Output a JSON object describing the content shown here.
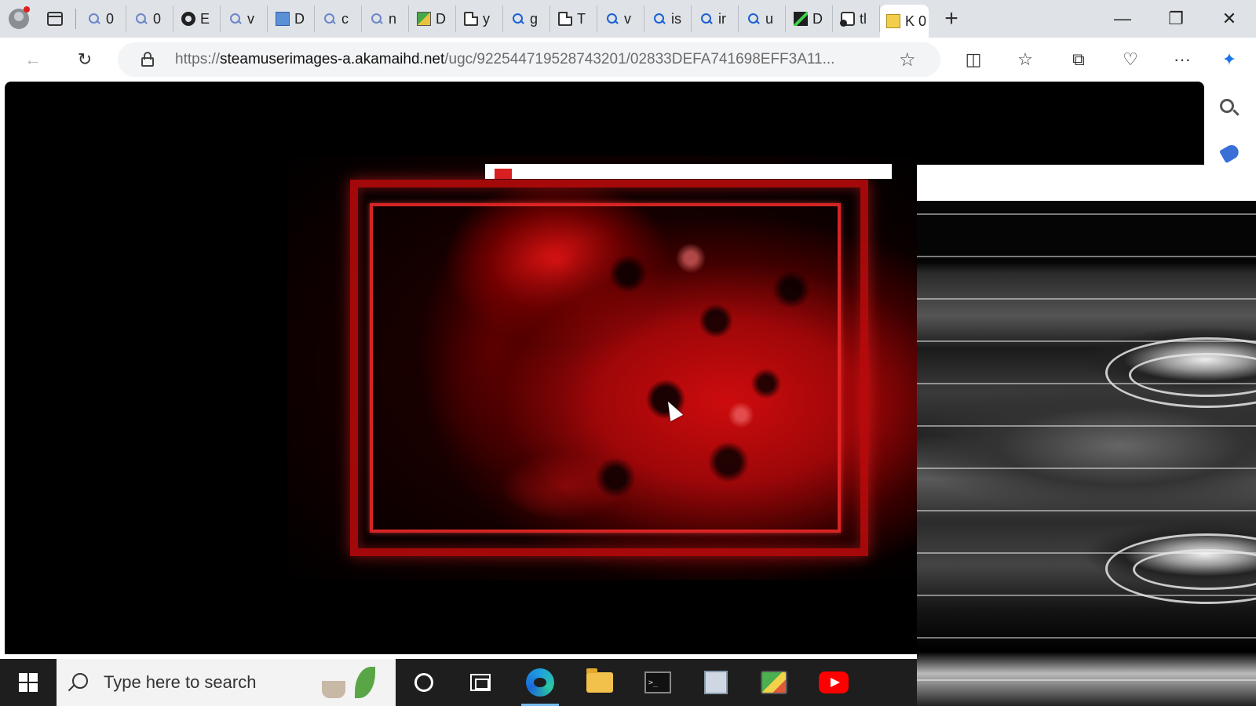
{
  "browser": {
    "tabs": [
      {
        "label": "0",
        "icon": "search-icon"
      },
      {
        "label": "0",
        "icon": "search-icon"
      },
      {
        "label": "E",
        "icon": "github-icon"
      },
      {
        "label": "v",
        "icon": "search-icon"
      },
      {
        "label": "D",
        "icon": "chart-icon"
      },
      {
        "label": "c",
        "icon": "search-icon"
      },
      {
        "label": "n",
        "icon": "search-icon"
      },
      {
        "label": "D",
        "icon": "paint-icon"
      },
      {
        "label": "y",
        "icon": "document-icon"
      },
      {
        "label": "g",
        "icon": "search-icon"
      },
      {
        "label": "T",
        "icon": "document-icon"
      },
      {
        "label": "v",
        "icon": "search-icon"
      },
      {
        "label": "is",
        "icon": "search-icon"
      },
      {
        "label": "ir",
        "icon": "search-icon"
      },
      {
        "label": "u",
        "icon": "search-icon"
      },
      {
        "label": "D",
        "icon": "lightning-icon"
      },
      {
        "label": "tl",
        "icon": "muted-tab-icon"
      }
    ],
    "active_tab": {
      "label": "K 0",
      "icon": "yellow-note-icon",
      "close_glyph": "✕"
    },
    "new_tab_glyph": "+",
    "window_controls": {
      "minimize": "—",
      "restore": "❐",
      "close": "✕"
    },
    "address": {
      "scheme": "https://",
      "host": "steamuserimages-a.akamaihd.net",
      "path": "/ugc/922544719528743201/02833DEFA741698EFF3A11..."
    },
    "toolbar_glyphs": {
      "back": "←",
      "reload": "↻",
      "favorite": "☆",
      "split": "◫",
      "favorites": "☆",
      "collections": "⧉",
      "health": "♡",
      "more": "···",
      "copilot": "✦"
    }
  },
  "taskbar": {
    "search_placeholder": "Type here to search",
    "apps": [
      "cortana-icon",
      "task-view-icon",
      "edge-icon",
      "file-explorer-icon",
      "terminal-icon",
      "notepad-icon",
      "paint-icon",
      "youtube-icon"
    ],
    "active_app": "edge-icon"
  },
  "colors": {
    "tabstrip": "#dfe3e8",
    "accent_red": "#d82020",
    "taskbar": "#1e1e1e"
  }
}
